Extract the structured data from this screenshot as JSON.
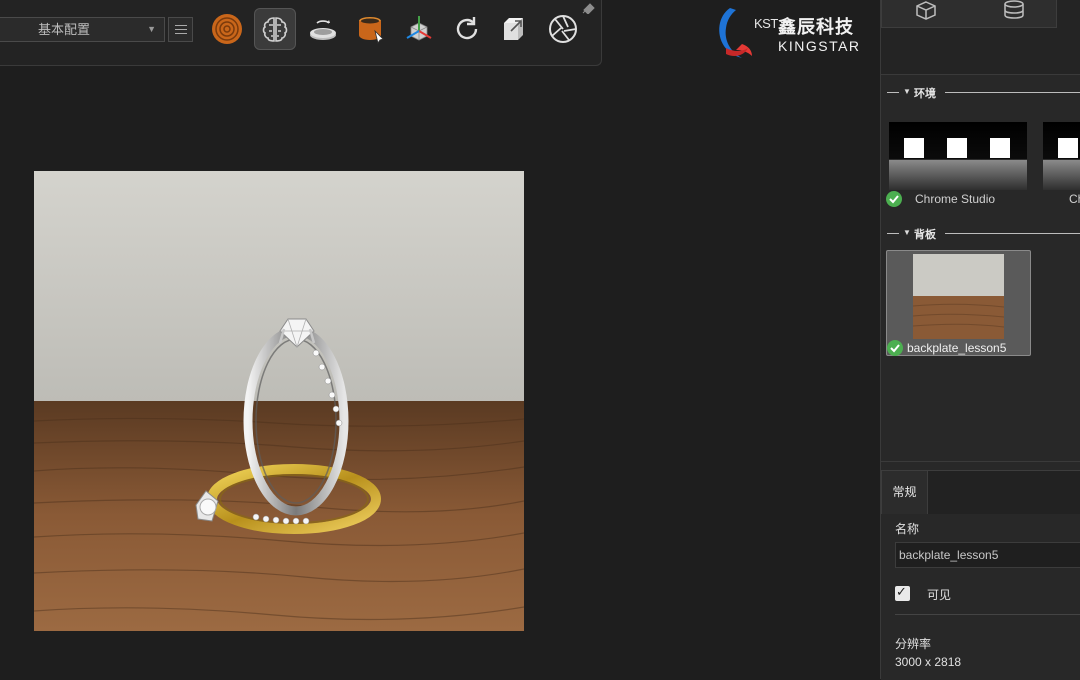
{
  "toolbar": {
    "preset_select": {
      "value": "基本配置"
    },
    "tools": [
      {
        "name": "target-icon"
      },
      {
        "name": "brain-icon"
      },
      {
        "name": "turntable-icon"
      },
      {
        "name": "paint-bucket-icon"
      },
      {
        "name": "axis-cube-icon"
      },
      {
        "name": "refresh-icon"
      },
      {
        "name": "export-icon"
      },
      {
        "name": "aperture-icon"
      }
    ]
  },
  "logo": {
    "kst": "KST",
    "company_cn": "鑫辰科技",
    "company_en": "KINGSTAR"
  },
  "right_panel": {
    "environment": {
      "section_title": "环境",
      "items": [
        {
          "label": "Chrome Studio",
          "selected": true
        },
        {
          "label": "Ch",
          "selected": false
        }
      ]
    },
    "backplate": {
      "section_title": "背板",
      "items": [
        {
          "label": "backplate_lesson5",
          "selected": true
        }
      ]
    },
    "properties": {
      "tab_general": "常规",
      "name_label": "名称",
      "name_value": "backplate_lesson5",
      "visible_label": "可见",
      "visible_checked": true,
      "resolution_label": "分辨率",
      "resolution_value": "3000 x 2818"
    }
  },
  "colors": {
    "accent_check": "#4caf50",
    "brand_red": "#e53935",
    "brand_blue": "#1e88e5",
    "tool_orange": "#d5741d"
  }
}
